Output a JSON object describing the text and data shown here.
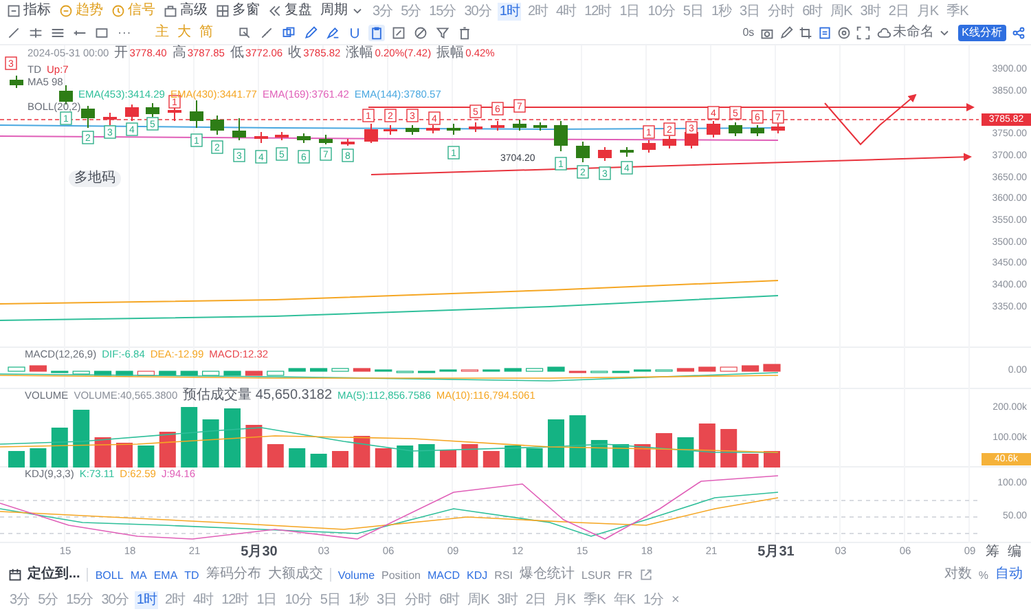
{
  "toolbar": {
    "tools": [
      {
        "label": "指标",
        "kind": "plain"
      },
      {
        "label": "趋势",
        "kind": "accent"
      },
      {
        "label": "信号",
        "kind": "accent"
      },
      {
        "label": "高级",
        "kind": "plain"
      },
      {
        "label": "多窗",
        "kind": "plain"
      },
      {
        "label": "复盘",
        "kind": "plain"
      },
      {
        "label": "周期",
        "kind": "dropdown"
      }
    ],
    "intervals": [
      {
        "label": "3分",
        "selected": false
      },
      {
        "label": "5分",
        "selected": false
      },
      {
        "label": "15分",
        "selected": false
      },
      {
        "label": "30分",
        "selected": false
      },
      {
        "label": "1时",
        "selected": true
      },
      {
        "label": "2时",
        "selected": false
      },
      {
        "label": "4时",
        "selected": false
      },
      {
        "label": "12时",
        "selected": false
      },
      {
        "label": "1日",
        "selected": false
      },
      {
        "label": "10分",
        "selected": false
      },
      {
        "label": "5日",
        "selected": false
      },
      {
        "label": "1秒",
        "selected": false
      },
      {
        "label": "3日",
        "selected": false
      },
      {
        "label": "分时",
        "selected": false
      },
      {
        "label": "6时",
        "selected": false
      },
      {
        "label": "周K",
        "selected": false
      },
      {
        "label": "3时",
        "selected": false
      },
      {
        "label": "2日",
        "selected": false
      },
      {
        "label": "月K",
        "selected": false
      },
      {
        "label": "季K",
        "selected": false
      }
    ],
    "refresh": "0s",
    "layout_name": "未命名",
    "analysis_button": "K线分析"
  },
  "drawing_toolbar": {
    "tools": [
      {
        "selected": false
      },
      {
        "selected": false
      },
      {
        "selected": false
      },
      {
        "selected": false
      },
      {
        "selected": false
      },
      {
        "selected": false
      },
      {
        "selected": false
      },
      {
        "selected": false
      },
      {
        "selected": false
      },
      {
        "selected": false
      },
      {
        "selected": false
      },
      {
        "selected": false
      },
      {
        "selected": true
      },
      {
        "selected": false
      },
      {
        "selected": false
      },
      {
        "selected": false
      },
      {
        "selected": false
      }
    ],
    "style_buttons": [
      "主",
      "大",
      "简"
    ]
  },
  "main_chart": {
    "ohlc": {
      "datetime": "2024-05-31 00:00",
      "fields": [
        {
          "label": "开",
          "value": "3778.40"
        },
        {
          "label": "高",
          "value": "3787.85"
        },
        {
          "label": "低",
          "value": "3772.06"
        },
        {
          "label": "收",
          "value": "3785.82"
        },
        {
          "label": "涨幅",
          "value": "0.20%(7.42)"
        },
        {
          "label": "振幅",
          "value": "0.42%"
        }
      ]
    },
    "td_legend": {
      "name": "TD",
      "value": "Up:7"
    },
    "ma_legend": "MA5 98",
    "ema": [
      {
        "label": "EMA(453):3414.29",
        "color": "#2fbf9a"
      },
      {
        "label": "EMA(430):3441.77",
        "color": "#f5a623"
      },
      {
        "label": "EMA(169):3761.42",
        "color": "#e05fb8"
      },
      {
        "label": "EMA(144):3780.57",
        "color": "#4aa8e0"
      }
    ],
    "boll_legend": "BOLL(20,2)",
    "td_marks": [
      {
        "label": "3",
        "kind": "sell"
      },
      {
        "label": "1",
        "kind": "buy"
      },
      {
        "label": "2",
        "kind": "buy"
      },
      {
        "label": "3",
        "kind": "buy"
      },
      {
        "label": "4",
        "kind": "buy"
      },
      {
        "label": "5",
        "kind": "buy"
      },
      {
        "label": "1",
        "kind": "sell"
      },
      {
        "label": "1",
        "kind": "buy"
      },
      {
        "label": "2",
        "kind": "buy"
      },
      {
        "label": "3",
        "kind": "buy"
      },
      {
        "label": "4",
        "kind": "buy"
      },
      {
        "label": "5",
        "kind": "buy"
      },
      {
        "label": "6",
        "kind": "buy"
      },
      {
        "label": "7",
        "kind": "buy"
      },
      {
        "label": "8",
        "kind": "buy"
      },
      {
        "label": "1",
        "kind": "sell"
      },
      {
        "label": "2",
        "kind": "sell"
      },
      {
        "label": "3",
        "kind": "sell"
      },
      {
        "label": "4",
        "kind": "sell"
      },
      {
        "label": "1",
        "kind": "buy"
      },
      {
        "label": "5",
        "kind": "sell"
      },
      {
        "label": "6",
        "kind": "sell"
      },
      {
        "label": "7",
        "kind": "sell"
      },
      {
        "label": "1",
        "kind": "buy"
      },
      {
        "label": "2",
        "kind": "buy"
      },
      {
        "label": "3",
        "kind": "buy"
      },
      {
        "label": "4",
        "kind": "buy"
      },
      {
        "label": "1",
        "kind": "sell"
      },
      {
        "label": "2",
        "kind": "sell"
      },
      {
        "label": "3",
        "kind": "sell"
      },
      {
        "label": "4",
        "kind": "sell"
      },
      {
        "label": "5",
        "kind": "sell"
      },
      {
        "label": "6",
        "kind": "sell"
      },
      {
        "label": "7",
        "kind": "sell"
      }
    ],
    "chart_label": "多地码",
    "low_label": "3704.20",
    "price_ticks": [
      "3900.00",
      "3850.00",
      "3750.00",
      "3700.00",
      "3650.00",
      "3600.00",
      "3550.00",
      "3500.00",
      "3450.00",
      "3400.00",
      "3350.00"
    ],
    "last_price": "3785.82"
  },
  "macd": {
    "name": "MACD(12,26,9)",
    "values": [
      {
        "label": "DIF:-6.84",
        "color": "#2fbf9a"
      },
      {
        "label": "DEA:-12.99",
        "color": "#f5a623"
      },
      {
        "label": "MACD:12.32",
        "color": "#e8484f"
      }
    ],
    "ticks": [
      "0.00"
    ]
  },
  "volume": {
    "name": "VOLUME",
    "values": [
      {
        "label": "VOLUME:40,565.3800",
        "color": "#8a8f99"
      },
      {
        "label": "预估成交量 45,650.3182",
        "color": "#5a5f69"
      },
      {
        "label": "MA(5):112,856.7586",
        "color": "#2fbf9a"
      },
      {
        "label": "MA(10):116,794.5061",
        "color": "#f5a623"
      }
    ],
    "ticks": [
      "200.00k",
      "100.00k"
    ],
    "last_volume": "40.6k"
  },
  "kdj": {
    "name": "KDJ(9,3,3)",
    "values": [
      {
        "label": "K:73.11",
        "color": "#2fbf9a"
      },
      {
        "label": "D:62.59",
        "color": "#f5a623"
      },
      {
        "label": "J:94.16",
        "color": "#e05fb8"
      }
    ],
    "ticks": [
      "100.00",
      "50.00"
    ]
  },
  "x_axis": [
    {
      "label": "15",
      "kind": "hour"
    },
    {
      "label": "18",
      "kind": "hour"
    },
    {
      "label": "21",
      "kind": "hour"
    },
    {
      "label": "5月30",
      "kind": "date"
    },
    {
      "label": "03",
      "kind": "hour"
    },
    {
      "label": "06",
      "kind": "hour"
    },
    {
      "label": "09",
      "kind": "hour"
    },
    {
      "label": "12",
      "kind": "hour"
    },
    {
      "label": "15",
      "kind": "hour"
    },
    {
      "label": "18",
      "kind": "hour"
    },
    {
      "label": "21",
      "kind": "hour"
    },
    {
      "label": "5月31",
      "kind": "date"
    },
    {
      "label": "03",
      "kind": "hour"
    },
    {
      "label": "06",
      "kind": "hour"
    },
    {
      "label": "09",
      "kind": "hour"
    }
  ],
  "axis_tools": [
    "筹",
    "编"
  ],
  "bottom_toolbar": {
    "locate": "定位到...",
    "indicators": [
      {
        "label": "BOLL",
        "selected": true
      },
      {
        "label": "MA",
        "selected": true
      },
      {
        "label": "EMA",
        "selected": true
      },
      {
        "label": "TD",
        "selected": true
      },
      {
        "label": "筹码分布",
        "selected": false
      },
      {
        "label": "大额成交",
        "selected": false
      }
    ],
    "sub_indicators": [
      {
        "label": "Volume",
        "selected": true
      },
      {
        "label": "Position",
        "selected": false
      },
      {
        "label": "MACD",
        "selected": true
      },
      {
        "label": "KDJ",
        "selected": true
      },
      {
        "label": "RSI",
        "selected": false
      },
      {
        "label": "爆仓统计",
        "selected": false
      },
      {
        "label": "LSUR",
        "selected": false
      },
      {
        "label": "FR",
        "selected": false
      }
    ],
    "scale_options": [
      {
        "label": "对数",
        "selected": false
      },
      {
        "label": "%",
        "selected": false
      },
      {
        "label": "自动",
        "selected": true
      }
    ]
  },
  "bottom_intervals": [
    {
      "label": "3分",
      "selected": false
    },
    {
      "label": "5分",
      "selected": false
    },
    {
      "label": "15分",
      "selected": false
    },
    {
      "label": "30分",
      "selected": false
    },
    {
      "label": "1时",
      "selected": true
    },
    {
      "label": "2时",
      "selected": false
    },
    {
      "label": "4时",
      "selected": false
    },
    {
      "label": "12时",
      "selected": false
    },
    {
      "label": "1日",
      "selected": false
    },
    {
      "label": "10分",
      "selected": false
    },
    {
      "label": "5日",
      "selected": false
    },
    {
      "label": "1秒",
      "selected": false
    },
    {
      "label": "3日",
      "selected": false
    },
    {
      "label": "分时",
      "selected": false
    },
    {
      "label": "6时",
      "selected": false
    },
    {
      "label": "周K",
      "selected": false
    },
    {
      "label": "3时",
      "selected": false
    },
    {
      "label": "2日",
      "selected": false
    },
    {
      "label": "月K",
      "selected": false
    },
    {
      "label": "季K",
      "selected": false
    },
    {
      "label": "年K",
      "selected": false
    },
    {
      "label": "1分",
      "selected": false
    }
  ],
  "bottom_close": "×"
}
